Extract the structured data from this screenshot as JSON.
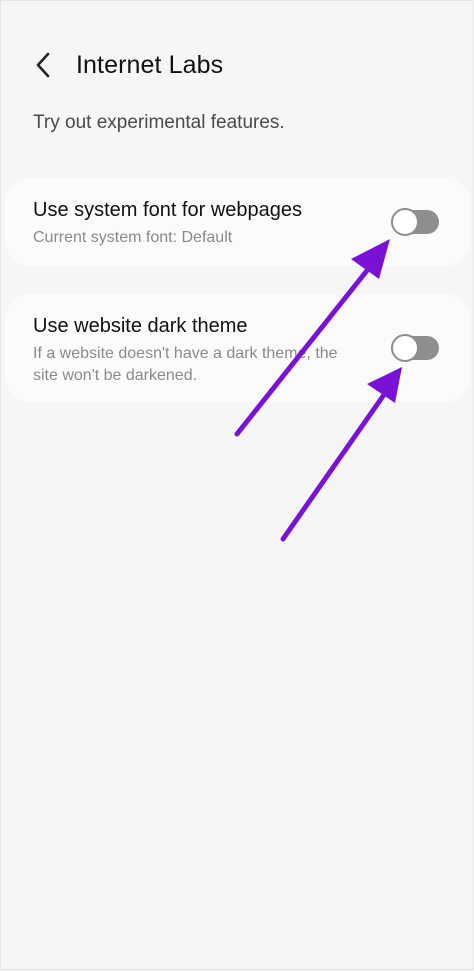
{
  "header": {
    "back_icon": "chevron-left-icon",
    "title": "Internet Labs"
  },
  "subtitle": "Try out experimental features.",
  "settings": [
    {
      "title": "Use system font for webpages",
      "description": "Current system font: Default",
      "enabled": false
    },
    {
      "title": "Use website dark theme",
      "description": "If a website doesn't have a dark theme, the site won't be darkened.",
      "enabled": false
    }
  ],
  "annotations": {
    "arrow_icon": "arrow-icon",
    "arrow_color": "#7a12d6"
  },
  "colors": {
    "background": "#f6f6f6",
    "card": "#fbfbfb",
    "toggle_off": "#8e8e8e"
  }
}
